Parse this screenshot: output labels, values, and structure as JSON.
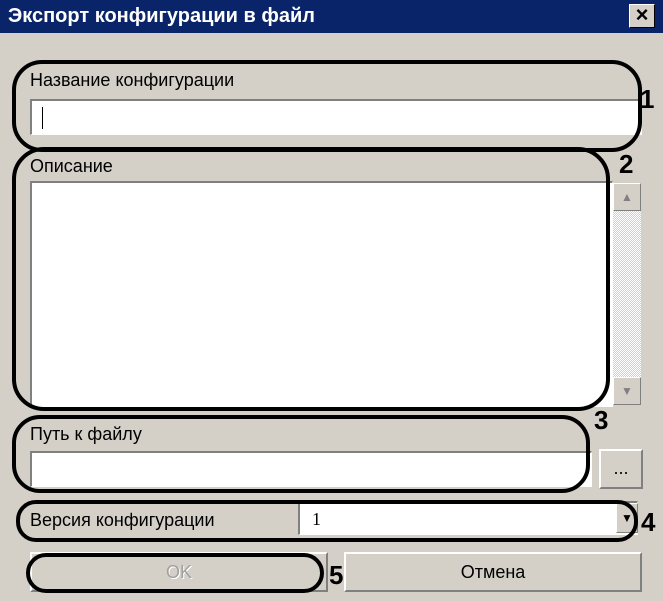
{
  "window": {
    "title": "Экспорт конфигурации в файл",
    "close_label": "×"
  },
  "config_name": {
    "label": "Название конфигурации",
    "value": ""
  },
  "description": {
    "label": "Описание",
    "value": ""
  },
  "file_path": {
    "label": "Путь к файлу",
    "value": "",
    "browse_label": "..."
  },
  "version": {
    "label": "Версия конфигурации",
    "value": "1"
  },
  "buttons": {
    "ok_label": "OK",
    "cancel_label": "Отмена"
  },
  "annotations": {
    "n1": "1",
    "n2": "2",
    "n3": "3",
    "n4": "4",
    "n5": "5"
  },
  "icons": {
    "scroll_up": "triangle-up",
    "scroll_down": "triangle-down",
    "combo": "triangle-down"
  }
}
